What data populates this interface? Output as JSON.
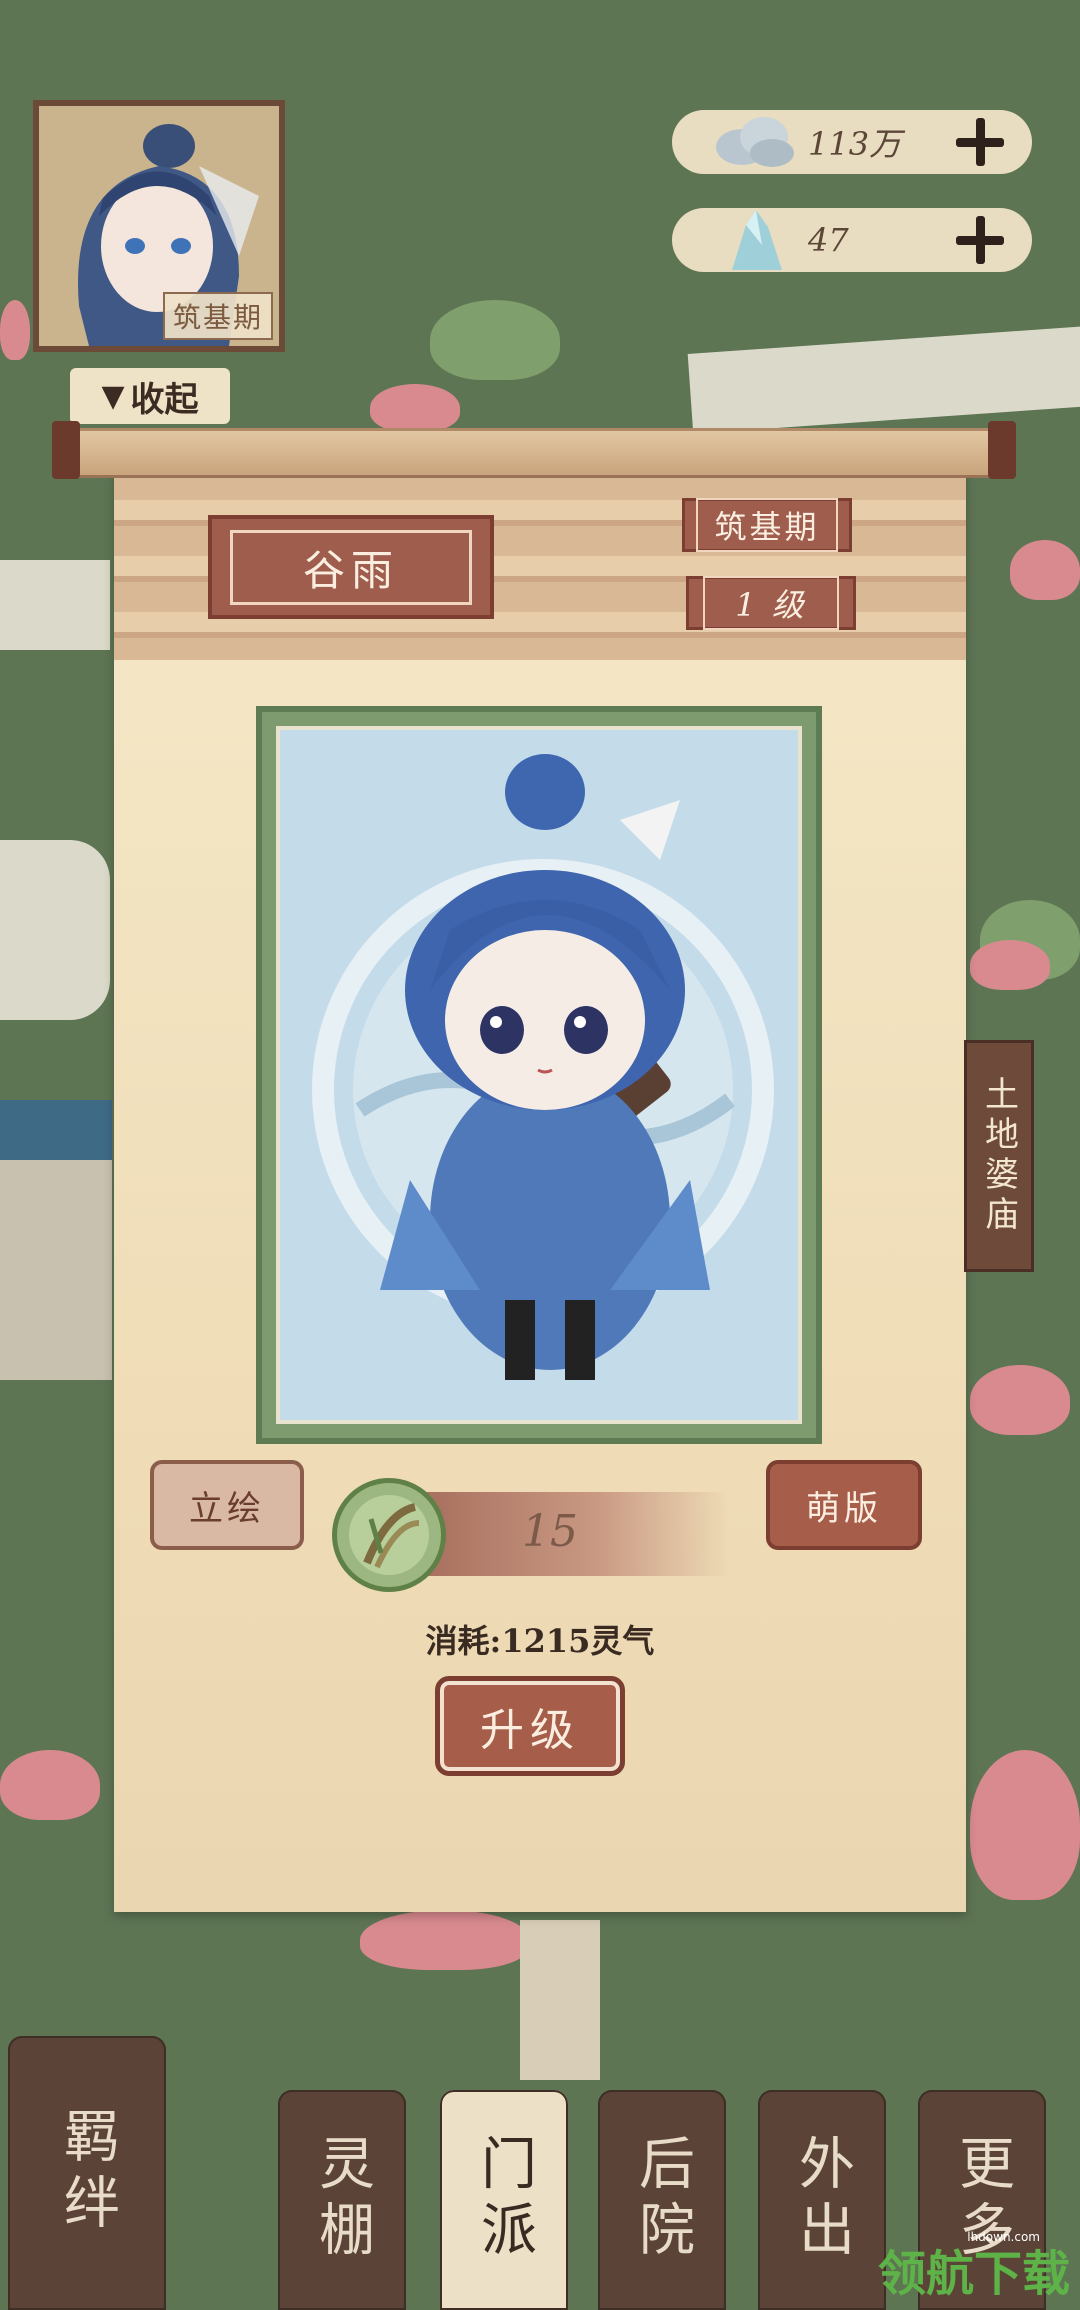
{
  "player": {
    "rank": "筑基期",
    "collapse_label": "收起"
  },
  "resources": [
    {
      "name": "coin",
      "value": "113万"
    },
    {
      "name": "gem",
      "value": "47"
    }
  ],
  "character": {
    "name": "谷雨",
    "rank": "筑基期",
    "level": "1  级"
  },
  "buttons": {
    "portrait": "立绘",
    "chibi": "萌版",
    "upgrade": "升级"
  },
  "upgrade": {
    "progress_value": "15",
    "cost_text": "消耗:1215灵气"
  },
  "map": {
    "temple_label": "土地婆庙"
  },
  "nav": {
    "items": [
      {
        "label": "羁绊"
      },
      {
        "label": "灵棚"
      },
      {
        "label": "门派"
      },
      {
        "label": "后院"
      },
      {
        "label": "外出"
      },
      {
        "label": "更多"
      }
    ],
    "active": "门派"
  },
  "watermark": {
    "text": "领航下载",
    "site": "lhdown.com"
  },
  "colors": {
    "background": "#5e7554",
    "panel": "#f5e8c8",
    "accent_red": "#9e5d4d",
    "nav_active": "#ece1c6"
  }
}
